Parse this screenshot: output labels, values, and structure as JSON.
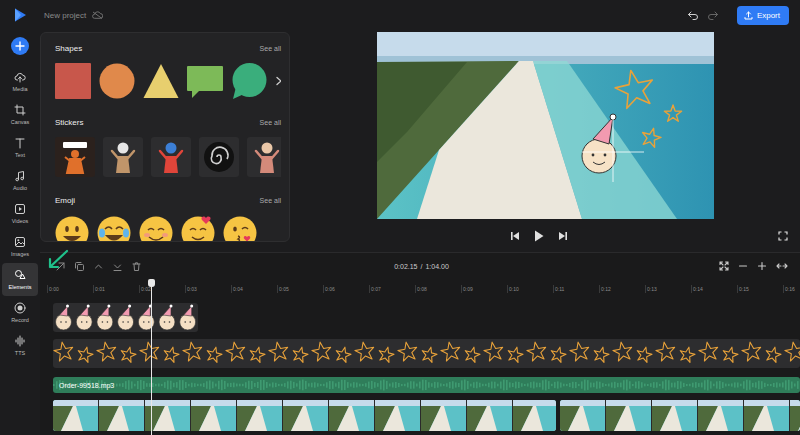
{
  "topbar": {
    "project_title": "New project",
    "export_button": "Export"
  },
  "sidebar": {
    "items": [
      {
        "label": "Media",
        "kind": "media",
        "selected": false
      },
      {
        "label": "Canvas",
        "kind": "canvas",
        "selected": false
      },
      {
        "label": "Text",
        "kind": "text",
        "selected": false
      },
      {
        "label": "Audio",
        "kind": "audio",
        "selected": false
      },
      {
        "label": "Videos",
        "kind": "videos",
        "selected": false
      },
      {
        "label": "Images",
        "kind": "images",
        "selected": false
      },
      {
        "label": "Elements",
        "kind": "elements",
        "selected": true
      },
      {
        "label": "Record",
        "kind": "record",
        "selected": false
      },
      {
        "label": "TTS",
        "kind": "tts",
        "selected": false
      }
    ]
  },
  "panel": {
    "sections": [
      {
        "title": "Shapes",
        "see_all": "See all",
        "kind": "shapes",
        "items": [
          {
            "kind": "square",
            "color": "#c8574b"
          },
          {
            "kind": "circle",
            "color": "#e0894b"
          },
          {
            "kind": "triangle",
            "color": "#e8cf6e"
          },
          {
            "kind": "bubble",
            "color": "#7dba58"
          },
          {
            "kind": "round-bubble",
            "color": "#3aae7c"
          }
        ]
      },
      {
        "title": "Stickers",
        "see_all": "See all",
        "kind": "stickers",
        "items": [
          {
            "kind": "winner"
          },
          {
            "kind": "dancer"
          },
          {
            "kind": "kid"
          },
          {
            "kind": "swirl"
          },
          {
            "kind": "woman"
          },
          {
            "kind": "robot"
          }
        ]
      },
      {
        "title": "Emoji",
        "see_all": "See all",
        "kind": "emoji",
        "items": [
          {
            "kind": "grin"
          },
          {
            "kind": "joy"
          },
          {
            "kind": "blush"
          },
          {
            "kind": "love"
          },
          {
            "kind": "kiss"
          }
        ]
      }
    ]
  },
  "timeline": {
    "current_time": "0:02.15",
    "separator": "/",
    "total_time": "1:04.00",
    "ruler": [
      "0:00",
      "0:01",
      "0:02",
      "0:03",
      "0:04",
      "0:05",
      "0:06",
      "0:07",
      "0:08",
      "0:09",
      "0:10",
      "0:11",
      "0:12",
      "0:13",
      "0:14",
      "0:15",
      "0:16"
    ],
    "tracks": [
      {
        "kind": "sticker"
      },
      {
        "kind": "stars"
      },
      {
        "kind": "audio",
        "label": "Order-99518.mp3"
      },
      {
        "kind": "video",
        "clips": 2
      }
    ]
  }
}
